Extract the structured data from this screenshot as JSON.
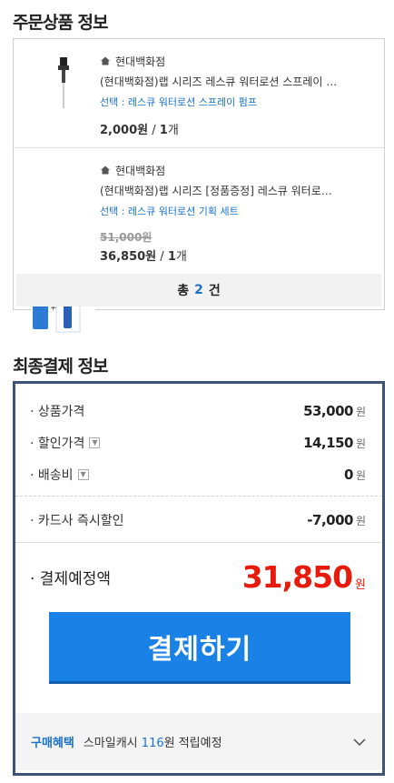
{
  "order": {
    "title": "주문상품 정보",
    "items": [
      {
        "seller": "현대백화점",
        "name": "(현대백화점)랩 시리즈 레스큐 워터로션 스프레이 …",
        "option": "선택 : 레스큐 워터로션 스프레이 펌프",
        "original_price": "",
        "price": "2,000",
        "price_unit": "원",
        "qty_sep": "/",
        "qty": "1",
        "qty_unit": "개"
      },
      {
        "seller": "현대백화점",
        "name": "(현대백화점)랩 시리즈 [정품증정] 레스큐 워터로…",
        "option": "선택 : 레스큐 워터로션 기획 세트",
        "original_price": "51,000원",
        "price": "36,850",
        "price_unit": "원",
        "qty_sep": "/",
        "qty": "1",
        "qty_unit": "개"
      }
    ],
    "total_prefix": "총",
    "total_count": "2",
    "total_suffix": "건"
  },
  "payment": {
    "title": "최종결제 정보",
    "rows": [
      {
        "label": "· 상품가격",
        "value": "53,000",
        "unit": "원"
      },
      {
        "label": "· 할인가격",
        "value": "14,150",
        "unit": "원"
      },
      {
        "label": "· 배송비",
        "value": "0",
        "unit": "원"
      },
      {
        "label": "· 카드사 즉시할인",
        "value": "-7,000",
        "unit": "원"
      }
    ],
    "total_label": "· 결제예정액",
    "total_value": "31,850",
    "total_unit": "원",
    "pay_button": "결제하기",
    "benefit_tag": "구매혜택",
    "benefit_text": "스마일캐시",
    "benefit_amount": "116",
    "benefit_suffix": "원 적립예정"
  },
  "colors": {
    "accent_blue": "#1a82e6",
    "price_red": "#e61b0c",
    "box_border": "#3d5373"
  }
}
